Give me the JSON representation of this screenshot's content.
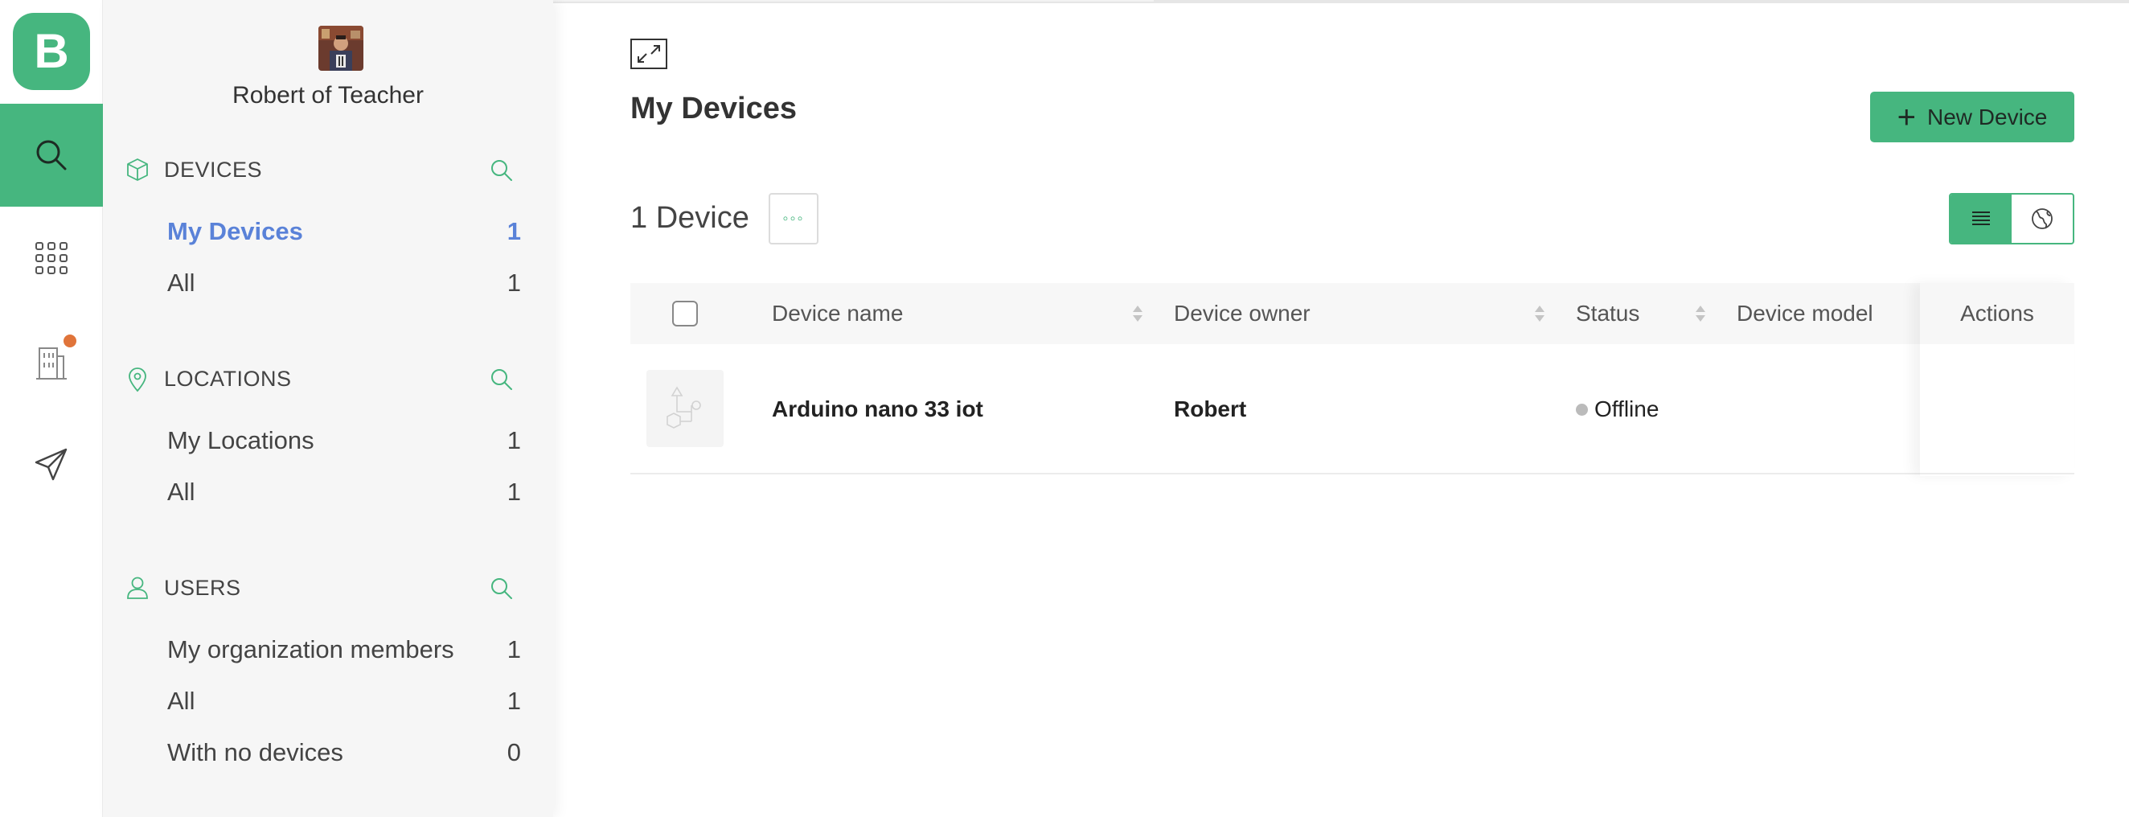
{
  "app": {
    "logo_letter": "B",
    "brand_color": "#46b67f",
    "accent_link_color": "#5a82d8",
    "notification_color": "#e0743a"
  },
  "rail": {
    "items": [
      {
        "name": "search",
        "icon": "search-icon",
        "active": true
      },
      {
        "name": "apps",
        "icon": "grid-icon",
        "active": false
      },
      {
        "name": "organizations",
        "icon": "building-icon",
        "active": false,
        "has_notification": true
      },
      {
        "name": "messages",
        "icon": "paper-plane-icon",
        "active": false
      }
    ]
  },
  "sidebar": {
    "org_name": "Robert of Teacher",
    "sections": [
      {
        "title": "DEVICES",
        "icon": "cube-icon",
        "items": [
          {
            "label": "My Devices",
            "count": "1",
            "active": true
          },
          {
            "label": "All",
            "count": "1",
            "active": false
          }
        ]
      },
      {
        "title": "LOCATIONS",
        "icon": "map-pin-icon",
        "items": [
          {
            "label": "My Locations",
            "count": "1",
            "active": false
          },
          {
            "label": "All",
            "count": "1",
            "active": false
          }
        ]
      },
      {
        "title": "USERS",
        "icon": "user-icon",
        "items": [
          {
            "label": "My organization members",
            "count": "1",
            "active": false
          },
          {
            "label": "All",
            "count": "1",
            "active": false
          },
          {
            "label": "With no devices",
            "count": "0",
            "active": false
          }
        ]
      }
    ]
  },
  "main": {
    "title": "My Devices",
    "new_button_label": "New Device",
    "count_label": "1 Device",
    "more_button_glyph": "◦◦◦",
    "table": {
      "columns": [
        "Device name",
        "Device owner",
        "Status",
        "Device model",
        "Actions"
      ],
      "rows": [
        {
          "name": "Arduino nano 33 iot",
          "owner": "Robert",
          "status": "Offline",
          "model": ""
        }
      ]
    }
  }
}
